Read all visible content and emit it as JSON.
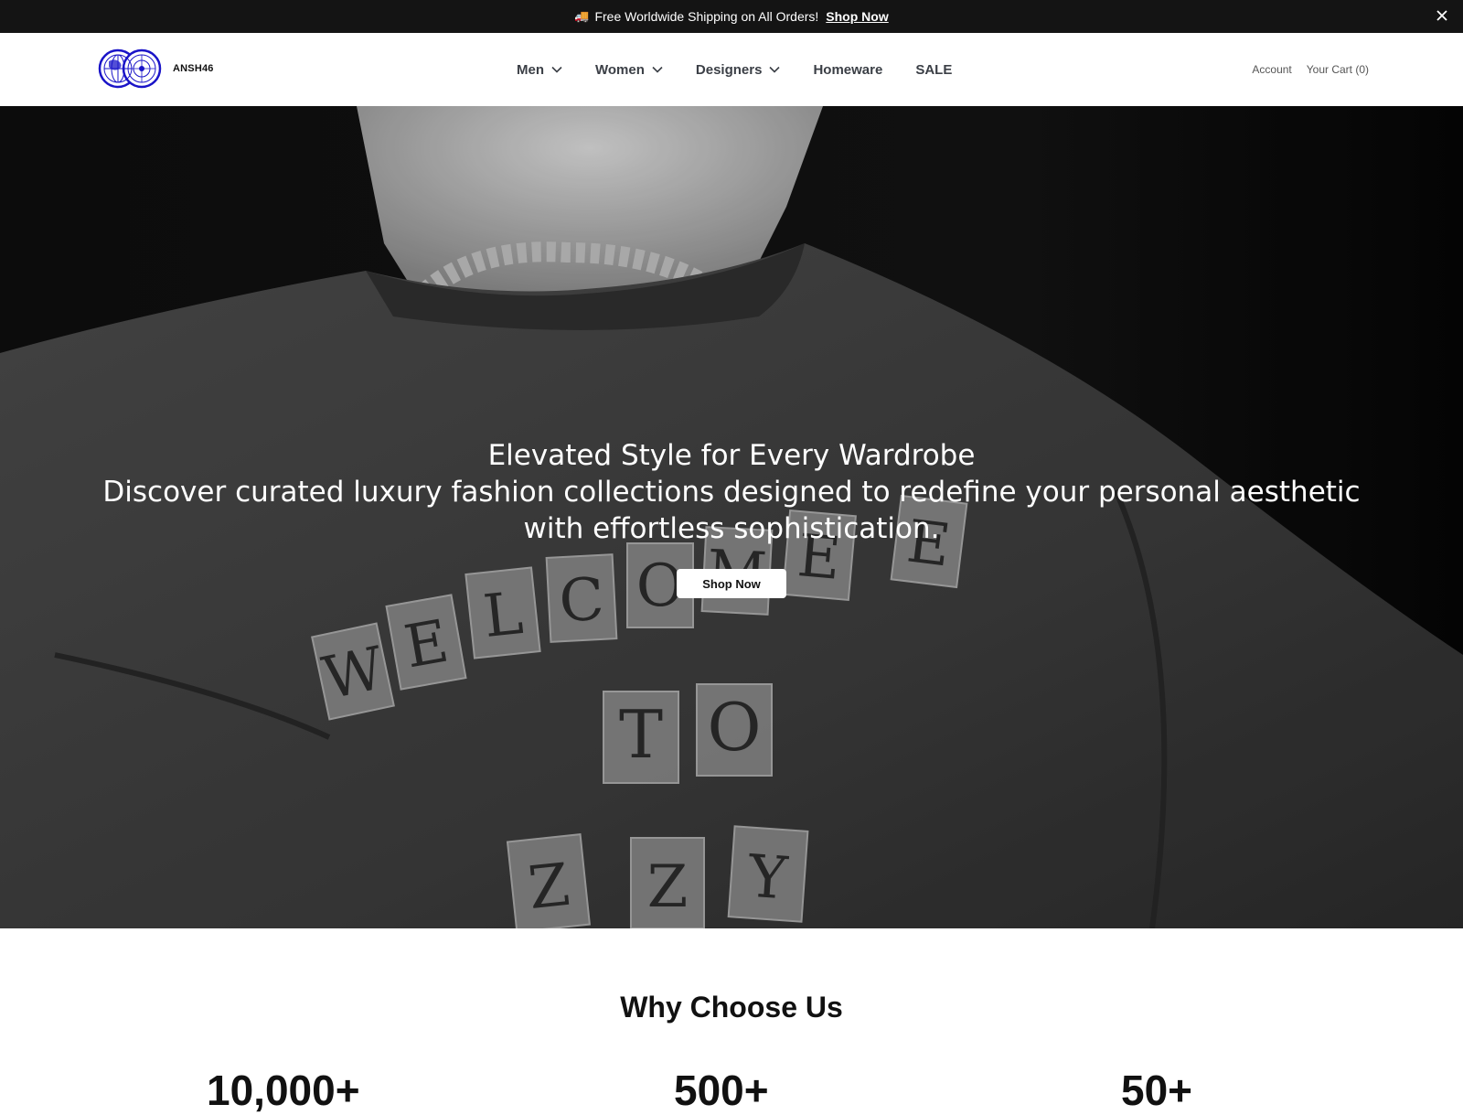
{
  "announcement": {
    "icon": "truck-icon",
    "message": "Free Worldwide Shipping on All Orders!",
    "link_label": "Shop Now"
  },
  "header": {
    "brand": "ANSH46",
    "nav": [
      {
        "label": "Men",
        "has_dropdown": true
      },
      {
        "label": "Women",
        "has_dropdown": true
      },
      {
        "label": "Designers",
        "has_dropdown": true
      },
      {
        "label": "Homeware",
        "has_dropdown": false
      },
      {
        "label": "SALE",
        "has_dropdown": false
      }
    ],
    "account_label": "Account",
    "cart_label": "Your Cart (0)"
  },
  "hero": {
    "title": "Elevated Style for Every Wardrobe",
    "subtitle": "Discover curated luxury fashion collections designed to redefine your personal aesthetic with effortless sophistication.",
    "cta_label": "Shop Now",
    "image_shirt_letters": [
      "W",
      "E",
      "L",
      "C",
      "O",
      "M",
      "E",
      "T",
      "O",
      "Z",
      "Y"
    ]
  },
  "why": {
    "title": "Why Choose Us",
    "stats": [
      "10,000+",
      "500+",
      "50+"
    ]
  },
  "colors": {
    "announcement_bg": "#141414",
    "logo_blue": "#1a14c8",
    "nav_text": "#3b3f46"
  }
}
